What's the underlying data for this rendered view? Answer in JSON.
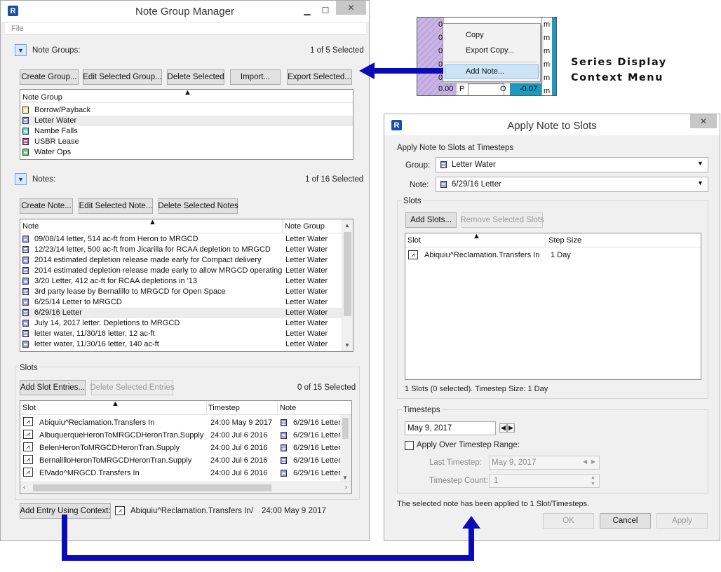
{
  "ngm": {
    "title": "Note Group Manager",
    "menu_file": "File",
    "note_groups_label": "Note Groups:",
    "note_groups_count": "1 of 5 Selected",
    "buttons": [
      "Create Group...",
      "Edit Selected Group...",
      "Delete Selected",
      "Import...",
      "Export Selected..."
    ],
    "groups_header": "Note Group",
    "groups": [
      {
        "name": "Borrow/Payback",
        "color": "#f2e89a"
      },
      {
        "name": "Letter Water",
        "color": "#8a93e0"
      },
      {
        "name": "Nambe Falls",
        "color": "#5fd0d8"
      },
      {
        "name": "USBR Lease",
        "color": "#c640a8"
      },
      {
        "name": "Water Ops",
        "color": "#5fc65f"
      }
    ],
    "notes_label": "Notes:",
    "notes_count": "1 of 16 Selected",
    "note_buttons": [
      "Create Note...",
      "Edit Selected Note...",
      "Delete Selected Notes"
    ],
    "notes_headers": [
      "Note",
      "Note Group"
    ],
    "notes": [
      [
        "09/08/14 letter, 514 ac-ft from Heron to MRGCD",
        "Letter Water"
      ],
      [
        "12/23/14 letter, 500 ac-ft from Jicarilla for RCAA depletion to MRGCD",
        "Letter Water"
      ],
      [
        "2014 estimated depletion release made early for Compact delivery",
        "Letter Water"
      ],
      [
        "2014 estimated depletion release made early to allow MRGCD operating",
        "Letter Water"
      ],
      [
        "3/20 Letter, 412 ac-ft for RCAA depletions in '13",
        "Letter Water"
      ],
      [
        "3rd party lease by Bernalillo to MRGCD for Open Space",
        "Letter Water"
      ],
      [
        "6/25/14 Letter to MRGCD",
        "Letter Water"
      ],
      [
        "6/29/16 Letter",
        "Letter Water"
      ],
      [
        "July 14, 2017 letter. Depletions to MRGCD",
        "Letter Water"
      ],
      [
        "letter water, 11/30/16 letter, 12 ac-ft",
        "Letter Water"
      ],
      [
        "letter water, 11/30/16 letter, 140 ac-ft",
        "Letter Water"
      ]
    ],
    "slots_label": "Slots",
    "slot_buttons": [
      "Add Slot Entries...",
      "Delete Selected Entries"
    ],
    "slots_count": "0 of 15 Selected",
    "slots_headers": [
      "Slot",
      "Timestep",
      "Note"
    ],
    "slots": [
      [
        "Abiquiu^Reclamation.Transfers In",
        "24:00 May 9 2017",
        "6/29/16 Letter"
      ],
      [
        "AlbuquerqueHeronToMRGCDHeronTran.Supply",
        "24:00 Jul 6 2016",
        "6/29/16 Letter"
      ],
      [
        "BelenHeronToMRGCDHeronTran.Supply",
        "24:00 Jul 6 2016",
        "6/29/16 Letter"
      ],
      [
        "BernalilloHeronToMRGCDHeronTran.Supply",
        "24:00 Jul 6 2016",
        "6/29/16 Letter"
      ],
      [
        "ElVado^MRGCD.Transfers In",
        "24:00 Jul 6 2016",
        "6/29/16 Letter"
      ]
    ],
    "add_context_button": "Add Entry Using Context:",
    "context_slot": "Abiquiu^Reclamation.Transfers In",
    "context_sep": "/",
    "context_time": "24:00 May 9 2017"
  },
  "ctx": {
    "items": [
      "Copy",
      "Export Copy...",
      "Add Note..."
    ],
    "cells": [
      "0",
      "0",
      "0",
      "0",
      "0",
      "0.00"
    ],
    "flag": "P",
    "o": "O",
    "value": "-0.07",
    "unit": "m"
  },
  "callout": {
    "line1": "Series Display",
    "line2": "Context Menu"
  },
  "ans": {
    "title": "Apply Note to Slots",
    "section": "Apply Note to Slots at Timesteps",
    "group_label": "Group:",
    "group_value": "Letter Water",
    "note_label": "Note:",
    "note_value": "6/29/16 Letter",
    "slots_label": "Slots",
    "add_slots": "Add Slots...",
    "remove_slots": "Remove Selected Slots",
    "slots_headers": [
      "Slot",
      "Step Size"
    ],
    "slot_row": [
      "Abiquiu^Reclamation.Transfers In",
      "1 Day"
    ],
    "slots_status": "1 Slots (0 selected).  Timestep Size: 1 Day",
    "timesteps_label": "Timesteps",
    "date_value": "May 9, 2017",
    "range_label": "Apply Over Timestep Range:",
    "last_label": "Last Timestep:",
    "last_value": "May 9, 2017",
    "count_label": "Timestep Count:",
    "count_value": "1",
    "message": "The selected note has been applied to 1 Slot/Timesteps.",
    "ok": "OK",
    "cancel": "Cancel",
    "apply": "Apply"
  }
}
